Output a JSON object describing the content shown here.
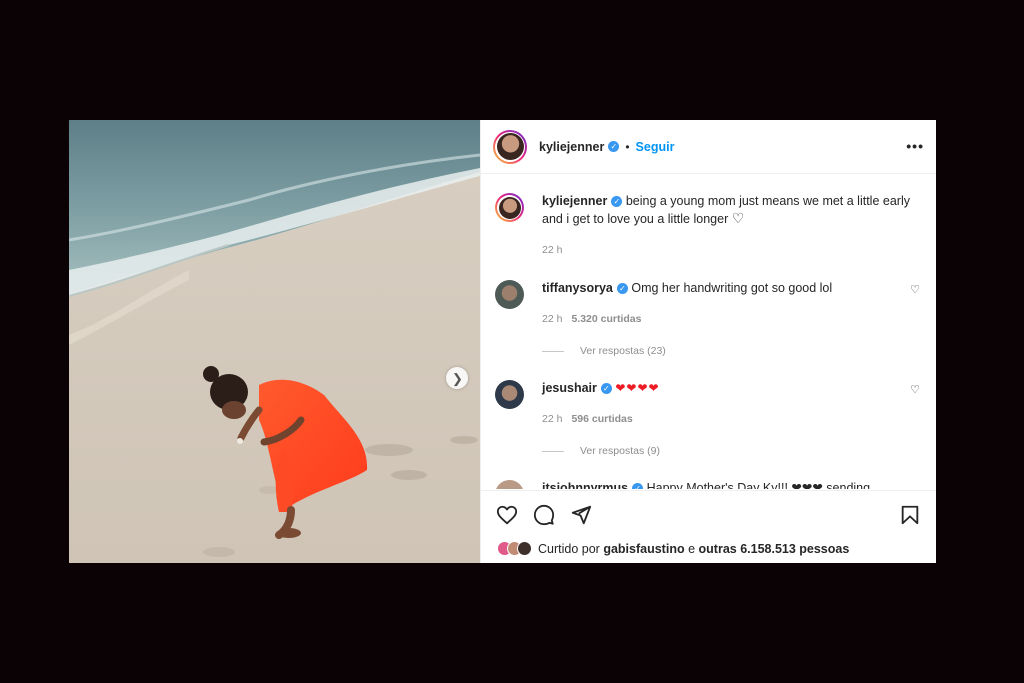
{
  "post": {
    "author": "kyliejenner",
    "follow_label": "Seguir",
    "dot": "•",
    "more": "•••",
    "caption": {
      "user": "kyliejenner",
      "text": "being a young mom just means we met a little early and i get to love you a little longer",
      "emoji": "♡",
      "time": "22 h"
    },
    "comments": [
      {
        "user": "tiffanysorya",
        "text": "Omg her handwriting got so good lol",
        "time": "22 h",
        "likes": "5.320 curtidas",
        "replies": "Ver respostas (23)"
      },
      {
        "user": "jesushair",
        "text": "❤❤❤❤",
        "time": "22 h",
        "likes": "596 curtidas",
        "replies": "Ver respostas (9)"
      },
      {
        "user": "itsjohnnyrmus",
        "text": "Happy Mother's Day Ky!!! ❤❤❤ sending"
      }
    ],
    "liked_by": {
      "prefix": "Curtido por",
      "user": "gabisfaustino",
      "mid": "e",
      "others": "outras 6.158.513 pessoas"
    }
  },
  "icons": {
    "next": "chevron-right-icon",
    "like": "heart-icon",
    "comment": "comment-icon",
    "share": "paper-plane-icon",
    "save": "bookmark-icon"
  },
  "colors": {
    "link": "#0095f6",
    "verified": "#3897f0",
    "text": "#262626",
    "muted": "#8e8e8e"
  }
}
